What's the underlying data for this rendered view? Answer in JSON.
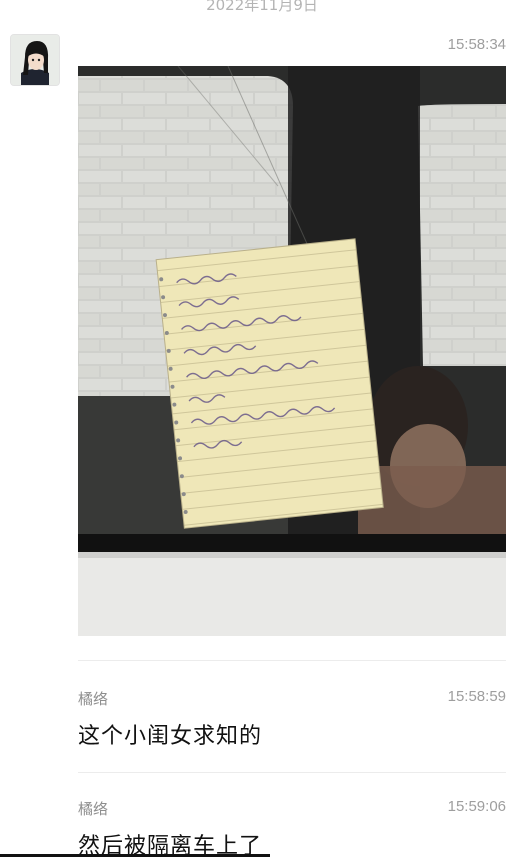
{
  "header": {
    "date": "2022年11月9日"
  },
  "messages": [
    {
      "sender": "",
      "time": "15:58:34",
      "type": "image"
    },
    {
      "sender": "橘络",
      "time": "15:58:59",
      "text": "这个小闺女求知的"
    },
    {
      "sender": "橘络",
      "time": "15:59:06",
      "text": "然后被隔离车上了"
    }
  ]
}
